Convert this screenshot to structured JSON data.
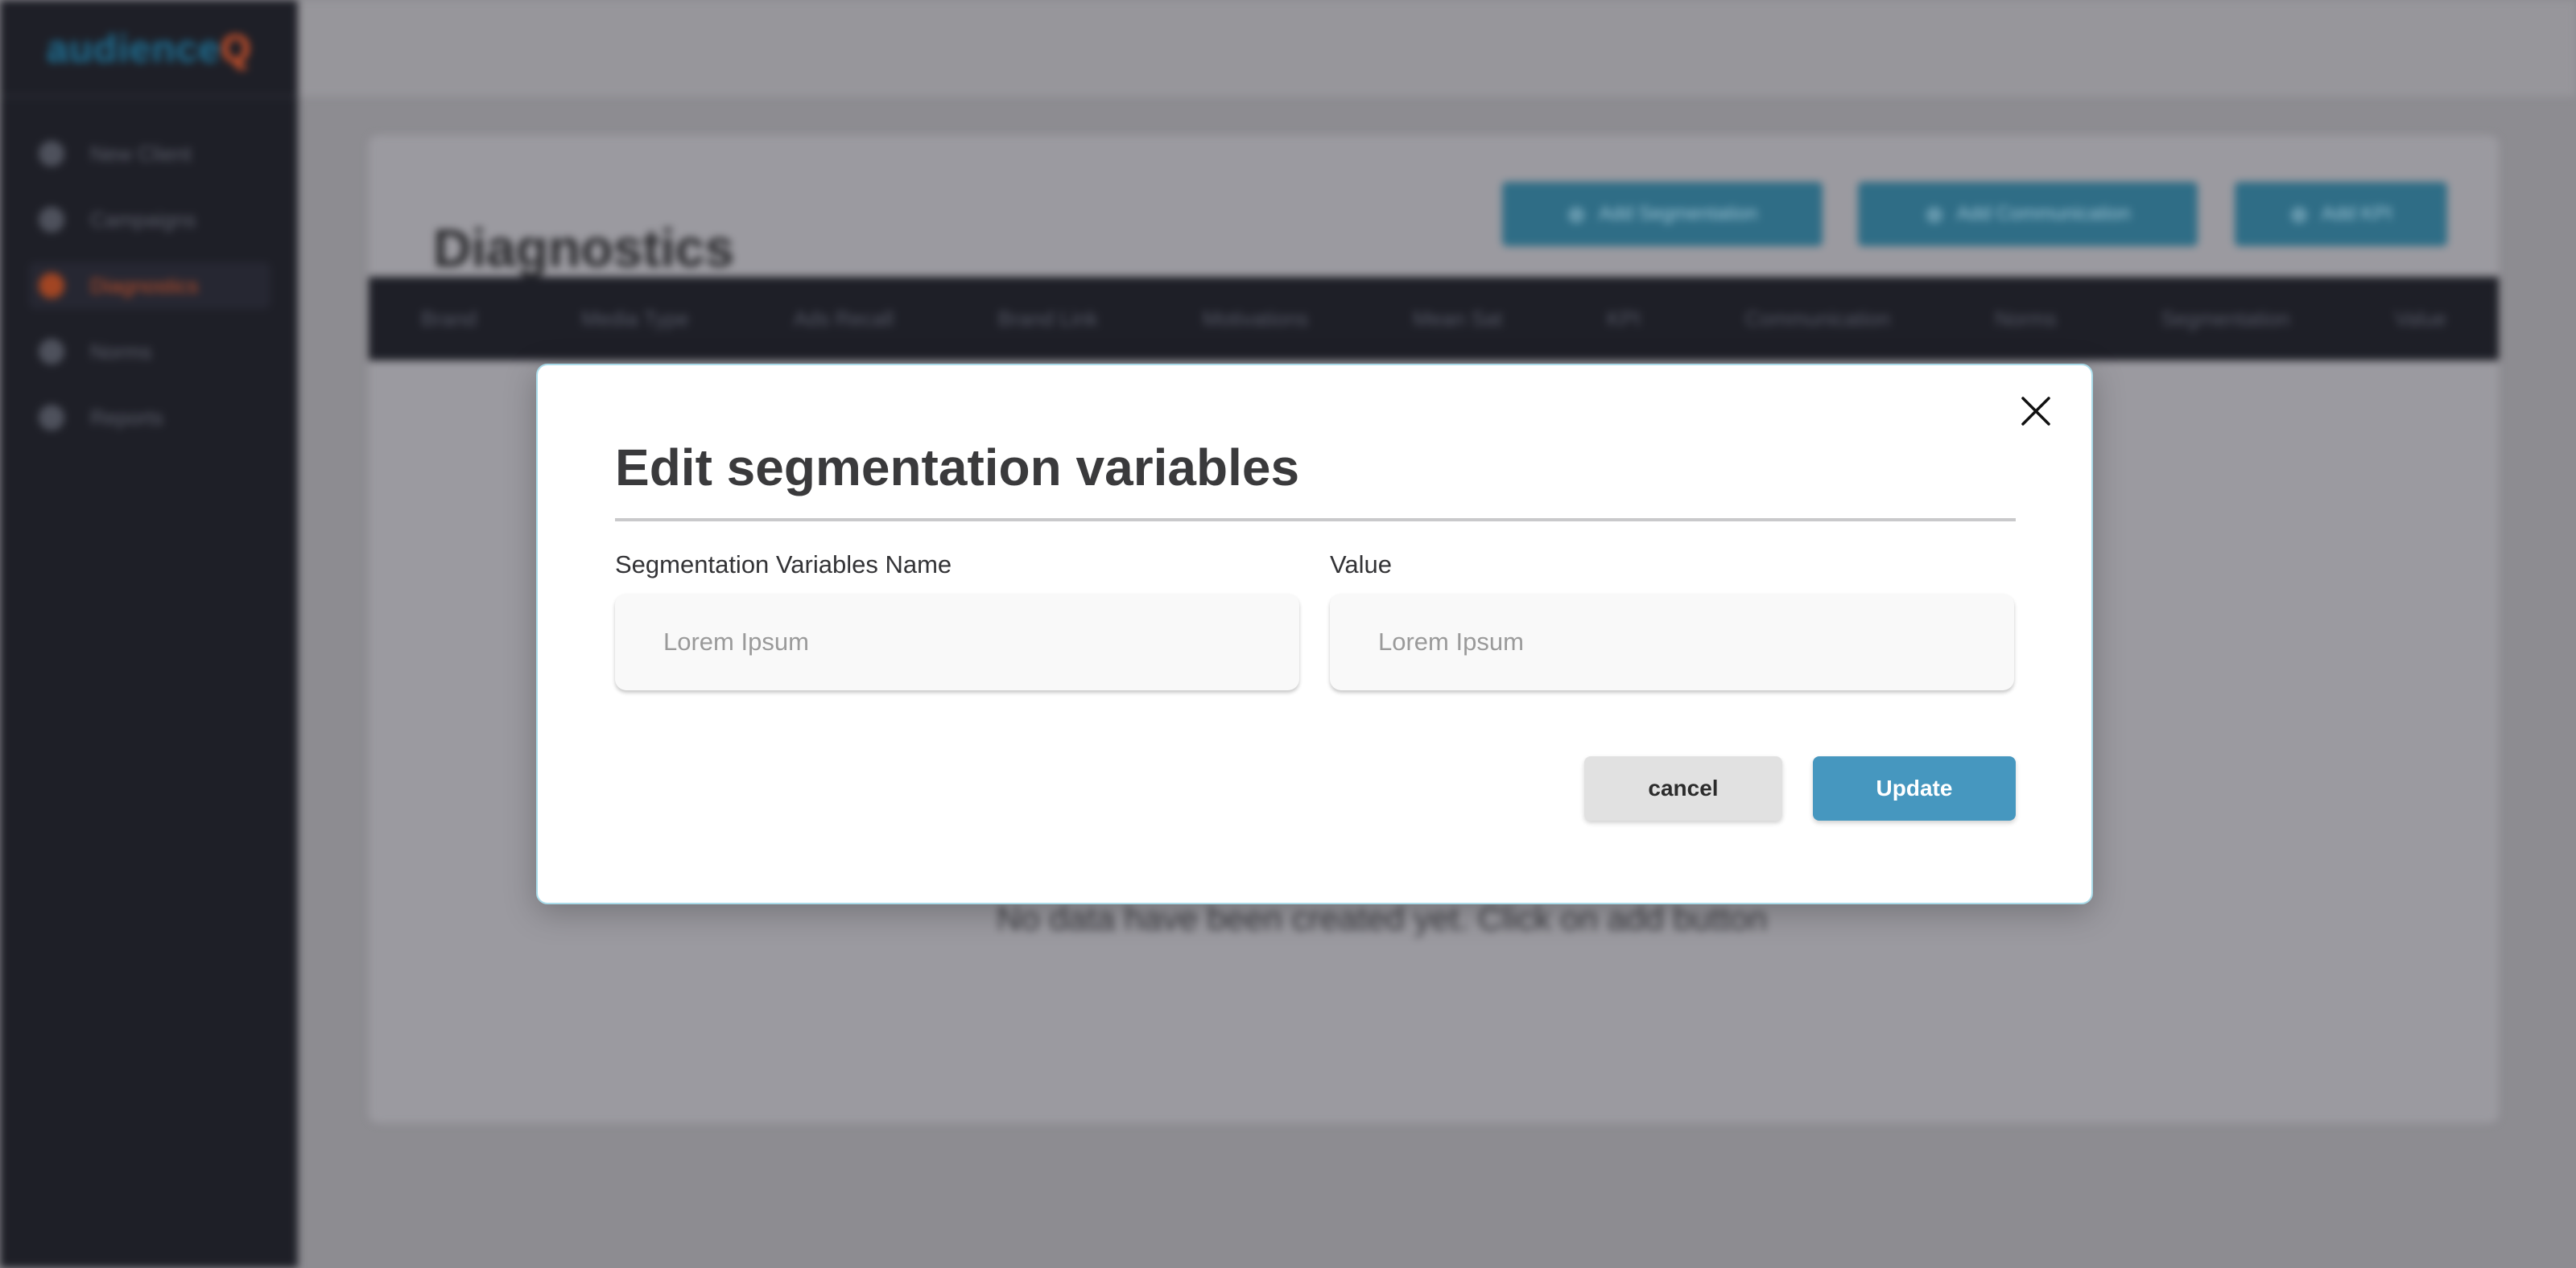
{
  "app": {
    "logo": {
      "part1": "audience",
      "part2": "Q",
      "accent_color": "#d4542b",
      "primary_color": "#1f6f93"
    },
    "sidebar": {
      "items": [
        {
          "label": "New Client",
          "icon": "client-icon",
          "active": false
        },
        {
          "label": "Campaigns",
          "icon": "campaigns-icon",
          "active": false
        },
        {
          "label": "Diagnostics",
          "icon": "diagnostics-icon",
          "active": true
        },
        {
          "label": "Norms",
          "icon": "norms-icon",
          "active": false
        },
        {
          "label": "Reports",
          "icon": "reports-icon",
          "active": false
        }
      ]
    },
    "page": {
      "title": "Diagnostics",
      "buttons": [
        {
          "label": "Add Segmentation",
          "icon": "plus-circle-icon"
        },
        {
          "label": "Add Communication",
          "icon": "plus-circle-icon"
        },
        {
          "label": "Add KPI",
          "icon": "plus-circle-icon"
        }
      ],
      "table_columns": [
        "Brand",
        "Media Type",
        "Ads Recall",
        "Brand Link",
        "Motivations",
        "Mean Sat",
        "KPI",
        "Communication",
        "Norms",
        "Segmentation",
        "Value"
      ],
      "empty_message": "No data have been created yet. Click on add button"
    }
  },
  "modal": {
    "title": "Edit segmentation variables",
    "close_icon": "close-icon",
    "fields": {
      "name": {
        "label": "Segmentation Variables Name",
        "placeholder": "Lorem Ipsum",
        "value": ""
      },
      "value": {
        "label": "Value",
        "placeholder": "Lorem Ipsum",
        "value": ""
      }
    },
    "buttons": {
      "cancel": "cancel",
      "update": "Update"
    },
    "colors": {
      "update_button": "#4697bf",
      "cancel_button": "#e1e1e1",
      "border_accent": "#a9dbe9"
    }
  }
}
